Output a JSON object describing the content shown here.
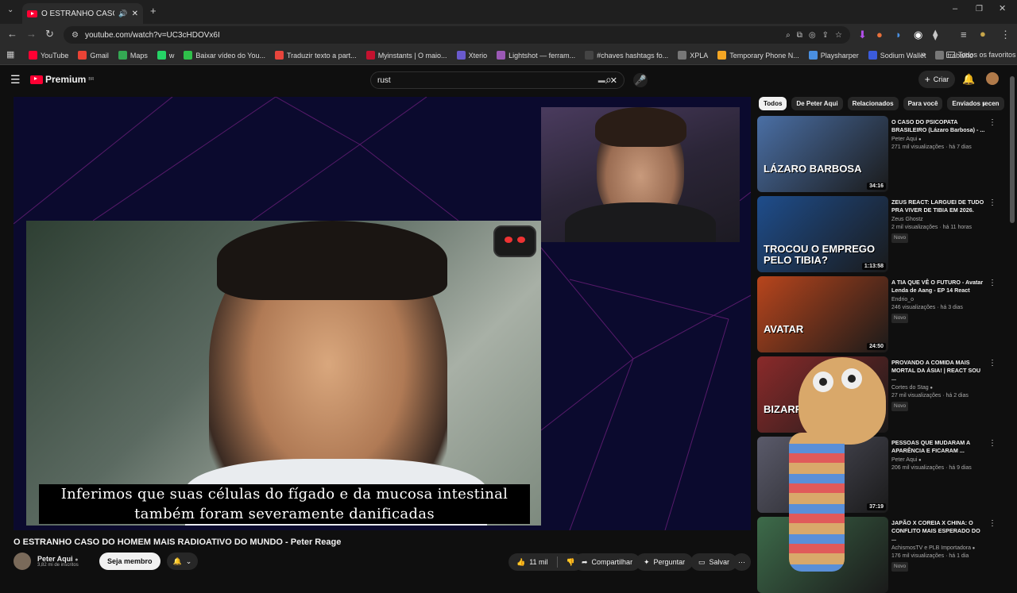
{
  "browser": {
    "tab_title": "O ESTRANHO CASO DO HOME",
    "url": "youtube.com/watch?v=UC3cHDOVx6I",
    "bookmarks": [
      {
        "label": "YouTube",
        "color": "#ff0033"
      },
      {
        "label": "Gmail",
        "color": "#ea4335"
      },
      {
        "label": "Maps",
        "color": "#34a853"
      },
      {
        "label": "w",
        "color": "#25d366"
      },
      {
        "label": "Baixar vídeo do You...",
        "color": "#2fbf4a"
      },
      {
        "label": "Traduzir texto a part...",
        "color": "#e8453c"
      },
      {
        "label": "Myinstants | O maio...",
        "color": "#c4122f"
      },
      {
        "label": "Xterio",
        "color": "#6a5acd"
      },
      {
        "label": "Lightshot — ferram...",
        "color": "#9b59b6"
      },
      {
        "label": "#chaves hashtags fo...",
        "color": "#444444"
      },
      {
        "label": "XPLA",
        "color": "#777777"
      },
      {
        "label": "Temporary Phone N...",
        "color": "#f5a623"
      },
      {
        "label": "Playsharper",
        "color": "#4a90e2"
      },
      {
        "label": "Sodium Wallet",
        "color": "#3b5bdb"
      },
      {
        "label": "trabalho",
        "color": "#777777"
      }
    ],
    "bookmarks_overflow": "»",
    "favorites_label": "Todos os favoritos"
  },
  "masthead": {
    "logo_text": "Premium",
    "logo_sup": "BR",
    "search_value": "rust",
    "create_label": "Criar"
  },
  "player": {
    "subtitle_line1": "Inferimos que suas células do fígado e da mucosa intestinal",
    "subtitle_line2": "também foram severamente danificadas"
  },
  "video": {
    "title": "O ESTRANHO CASO DO HOMEM MAIS RADIOATIVO DO MUNDO - Peter Reage",
    "channel": "Peter Aqui",
    "subscribers": "3,82 mi de inscritos",
    "member_label": "Seja membro",
    "likes": "11 mil",
    "share_label": "Compartilhar",
    "ask_label": "Perguntar",
    "save_label": "Salvar"
  },
  "chips": [
    "Todos",
    "De Peter Aqui",
    "Relacionados",
    "Para você",
    "Enviados recen"
  ],
  "recommendations": [
    {
      "title": "O CASO DO PSICOPATA BRASILEIRO (Lázaro Barbosa) - ...",
      "channel": "Peter Aqui",
      "meta": "271 mil visualizações · há 7 dias",
      "duration": "34:16",
      "badge": "",
      "thumb_text": "LÁZARO BARBOSA",
      "thumb_color": "#4a6fa5",
      "verified": true
    },
    {
      "title": "ZEUS REACT: LARGUEI DE TUDO PRA VIVER DE TIBIA EM 2026.",
      "channel": "Zeus Ghostz",
      "meta": "2 mil visualizações · há 11 horas",
      "duration": "1:13:58",
      "badge": "Novo",
      "thumb_text": "TROCOU O EMPREGO PELO TIBIA?",
      "thumb_color": "#1e4d8c",
      "verified": false
    },
    {
      "title": "A TIA QUE VÊ O FUTURO - Avatar Lenda de Aang - EP 14 React",
      "channel": "Endrio_o",
      "meta": "246 visualizações · há 3 dias",
      "duration": "24:50",
      "badge": "Novo",
      "thumb_text": "AVATAR",
      "thumb_color": "#b8451c",
      "verified": false
    },
    {
      "title": "PROVANDO A COMIDA MAIS MORTAL DA ÁSIA! | REACT SOU ...",
      "channel": "Cortes do Stag",
      "meta": "27 mil visualizações · há 2 dias",
      "duration": "",
      "badge": "Novo",
      "thumb_text": "BIZARRO",
      "thumb_color": "#8a2a2a",
      "verified": true
    },
    {
      "title": "PESSOAS QUE MUDARAM A APARÊNCIA E FICARAM ...",
      "channel": "Peter Aqui",
      "meta": "206 mil visualizações · há 9 dias",
      "duration": "37:19",
      "badge": "",
      "thumb_text": "",
      "thumb_color": "#5a5a6a",
      "verified": true
    },
    {
      "title": "JAPÃO X COREIA X CHINA: O CONFLITO MAIS ESPERADO DO ...",
      "channel": "AchismosTV e PLB Importadora",
      "meta": "176 mil visualizações · há 1 dia",
      "duration": "",
      "badge": "Novo",
      "thumb_text": "",
      "thumb_color": "#3d6b4a",
      "verified": true
    }
  ]
}
